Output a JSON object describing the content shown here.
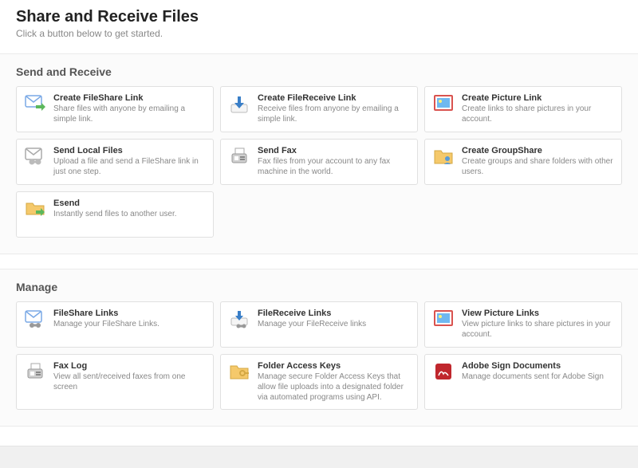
{
  "header": {
    "title": "Share and Receive Files",
    "subtitle": "Click a button below to get started."
  },
  "sections": {
    "send": {
      "title": "Send and Receive",
      "items": [
        {
          "title": "Create FileShare Link",
          "desc": "Share files with anyone by emailing a simple link."
        },
        {
          "title": "Create FileReceive Link",
          "desc": "Receive files from anyone by emailing a simple link."
        },
        {
          "title": "Create Picture Link",
          "desc": "Create links to share pictures in your account."
        },
        {
          "title": "Send Local Files",
          "desc": "Upload a file and send a FileShare link in just one step."
        },
        {
          "title": "Send Fax",
          "desc": "Fax files from your account to any fax machine in the world."
        },
        {
          "title": "Create GroupShare",
          "desc": "Create groups and share folders with other users."
        },
        {
          "title": "Esend",
          "desc": "Instantly send files to another user."
        }
      ]
    },
    "manage": {
      "title": "Manage",
      "items": [
        {
          "title": "FileShare Links",
          "desc": "Manage your FileShare Links."
        },
        {
          "title": "FileReceive Links",
          "desc": "Manage your FileReceive links"
        },
        {
          "title": "View Picture Links",
          "desc": "View picture links to share pictures in your account."
        },
        {
          "title": "Fax Log",
          "desc": "View all sent/received faxes from one screen"
        },
        {
          "title": "Folder Access Keys",
          "desc": "Manage secure Folder Access Keys that allow file uploads into a designated folder via automated programs using API."
        },
        {
          "title": "Adobe Sign Documents",
          "desc": "Manage documents sent for Adobe Sign"
        }
      ]
    }
  }
}
